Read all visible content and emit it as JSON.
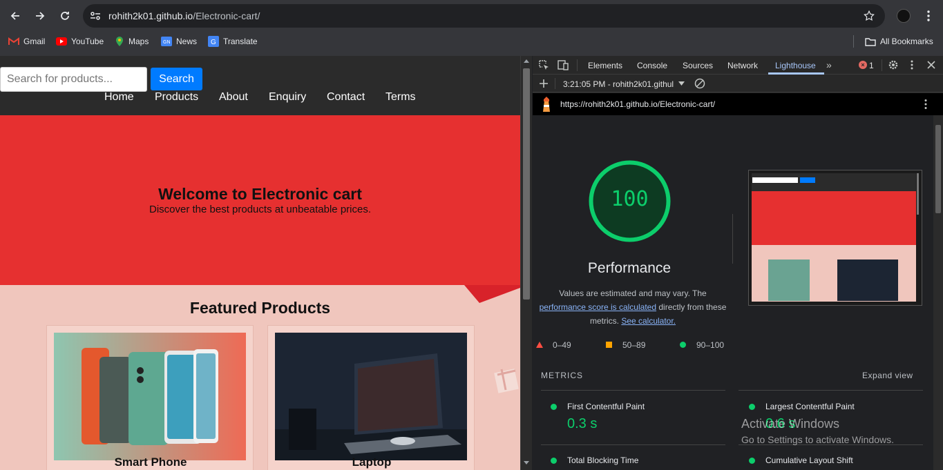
{
  "browser": {
    "url_host": "rohith2k01.github.io",
    "url_path": "/Electronic-cart/",
    "bookmarks": [
      "Gmail",
      "YouTube",
      "Maps",
      "News",
      "Translate"
    ],
    "all_bookmarks": "All Bookmarks"
  },
  "site": {
    "search_placeholder": "Search for products...",
    "search_button": "Search",
    "nav": [
      "Home",
      "Products",
      "About",
      "Enquiry",
      "Contact",
      "Terms"
    ],
    "hero_title": "Welcome to Electronic cart",
    "hero_subtitle": "Discover the best products at unbeatable prices.",
    "featured_title": "Featured Products",
    "products": [
      "Smart Phone",
      "Laptop"
    ]
  },
  "devtools": {
    "tabs": [
      "Elements",
      "Console",
      "Sources",
      "Network",
      "Lighthouse"
    ],
    "active_tab": "Lighthouse",
    "error_count": "1",
    "report_selector": "3:21:05 PM - rohith2k01.githul",
    "report_url": "https://rohith2k01.github.io/Electronic-cart/",
    "score": "100",
    "category": "Performance",
    "note_prefix": "Values are estimated and may vary. The",
    "note_link1": "performance score is calculated",
    "note_mid": "directly from these",
    "note_metrics": "metrics.",
    "note_link2": "See calculator.",
    "legend": [
      "0–49",
      "50–89",
      "90–100"
    ],
    "metrics_header": "METRICS",
    "expand_view": "Expand view",
    "metrics": [
      {
        "name": "First Contentful Paint",
        "value": "0.3 s"
      },
      {
        "name": "Largest Contentful Paint",
        "value": "0.6 s"
      },
      {
        "name": "Total Blocking Time",
        "value": ""
      },
      {
        "name": "Cumulative Layout Shift",
        "value": ""
      }
    ]
  },
  "watermark": {
    "line1": "Activate Windows",
    "line2": "Go to Settings to activate Windows."
  },
  "colors": {
    "accent_blue": "#007bff",
    "hero_red": "#e63030",
    "pass_green": "#0cce6b",
    "average_orange": "#ffa400",
    "fail_red": "#ff4e42"
  }
}
